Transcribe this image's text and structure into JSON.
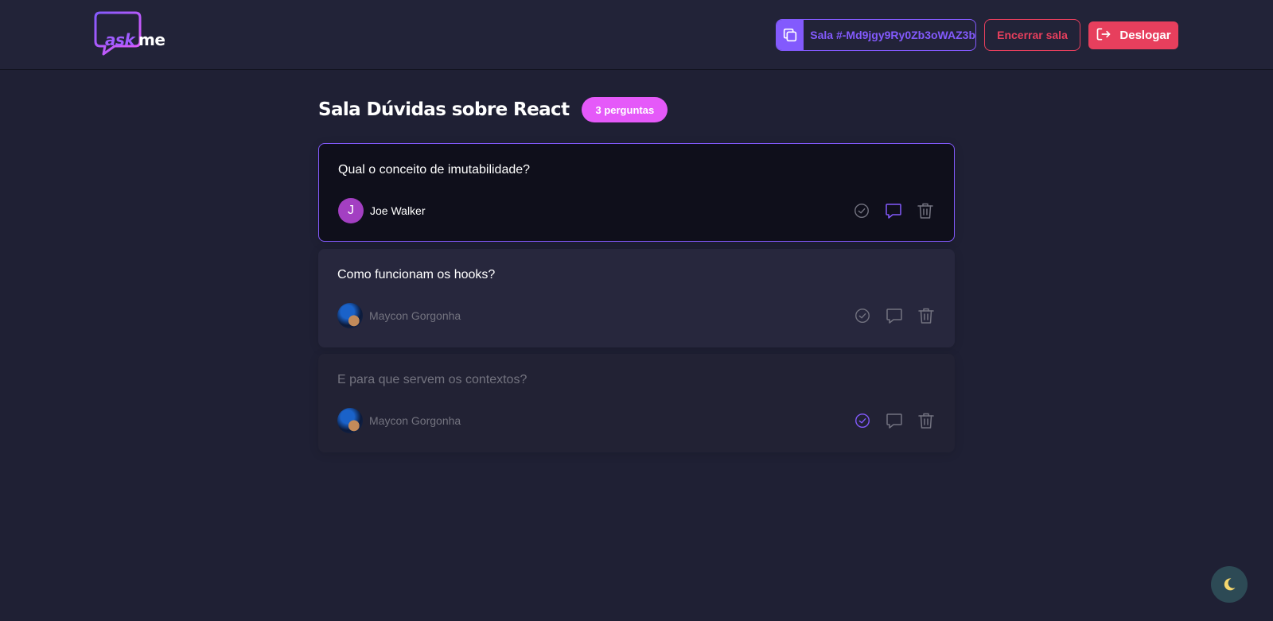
{
  "logo": {
    "ask": "ask",
    "me": "me",
    "accent": "#a05cff"
  },
  "header": {
    "room_code_label": "Sala #-Md9jgy9Ry0Zb3oWAZ3b",
    "end_room_label": "Encerrar sala",
    "logout_label": "Deslogar"
  },
  "room": {
    "title": "Sala Dúvidas sobre React",
    "questions_count": "3 perguntas"
  },
  "questions": [
    {
      "text": "Qual o conceito de imutabilidade?",
      "author": "Joe Walker",
      "avatar_letter": "J",
      "highlighted": true,
      "answered": false
    },
    {
      "text": "Como funcionam os hooks?",
      "author": "Maycon Gorgonha",
      "highlighted": false,
      "answered": false
    },
    {
      "text": "E para que servem os contextos?",
      "author": "Maycon Gorgonha",
      "highlighted": false,
      "answered": true
    }
  ],
  "icons": {
    "copy": "copy-icon",
    "logout": "logout-icon",
    "check": "check-circle-icon",
    "answer": "answer-icon",
    "delete": "trash-icon",
    "theme": "moon-icon"
  },
  "colors": {
    "primary": "#835afd",
    "danger": "#e73f5d",
    "badge": "#e559f9",
    "background": "#1f2034"
  }
}
